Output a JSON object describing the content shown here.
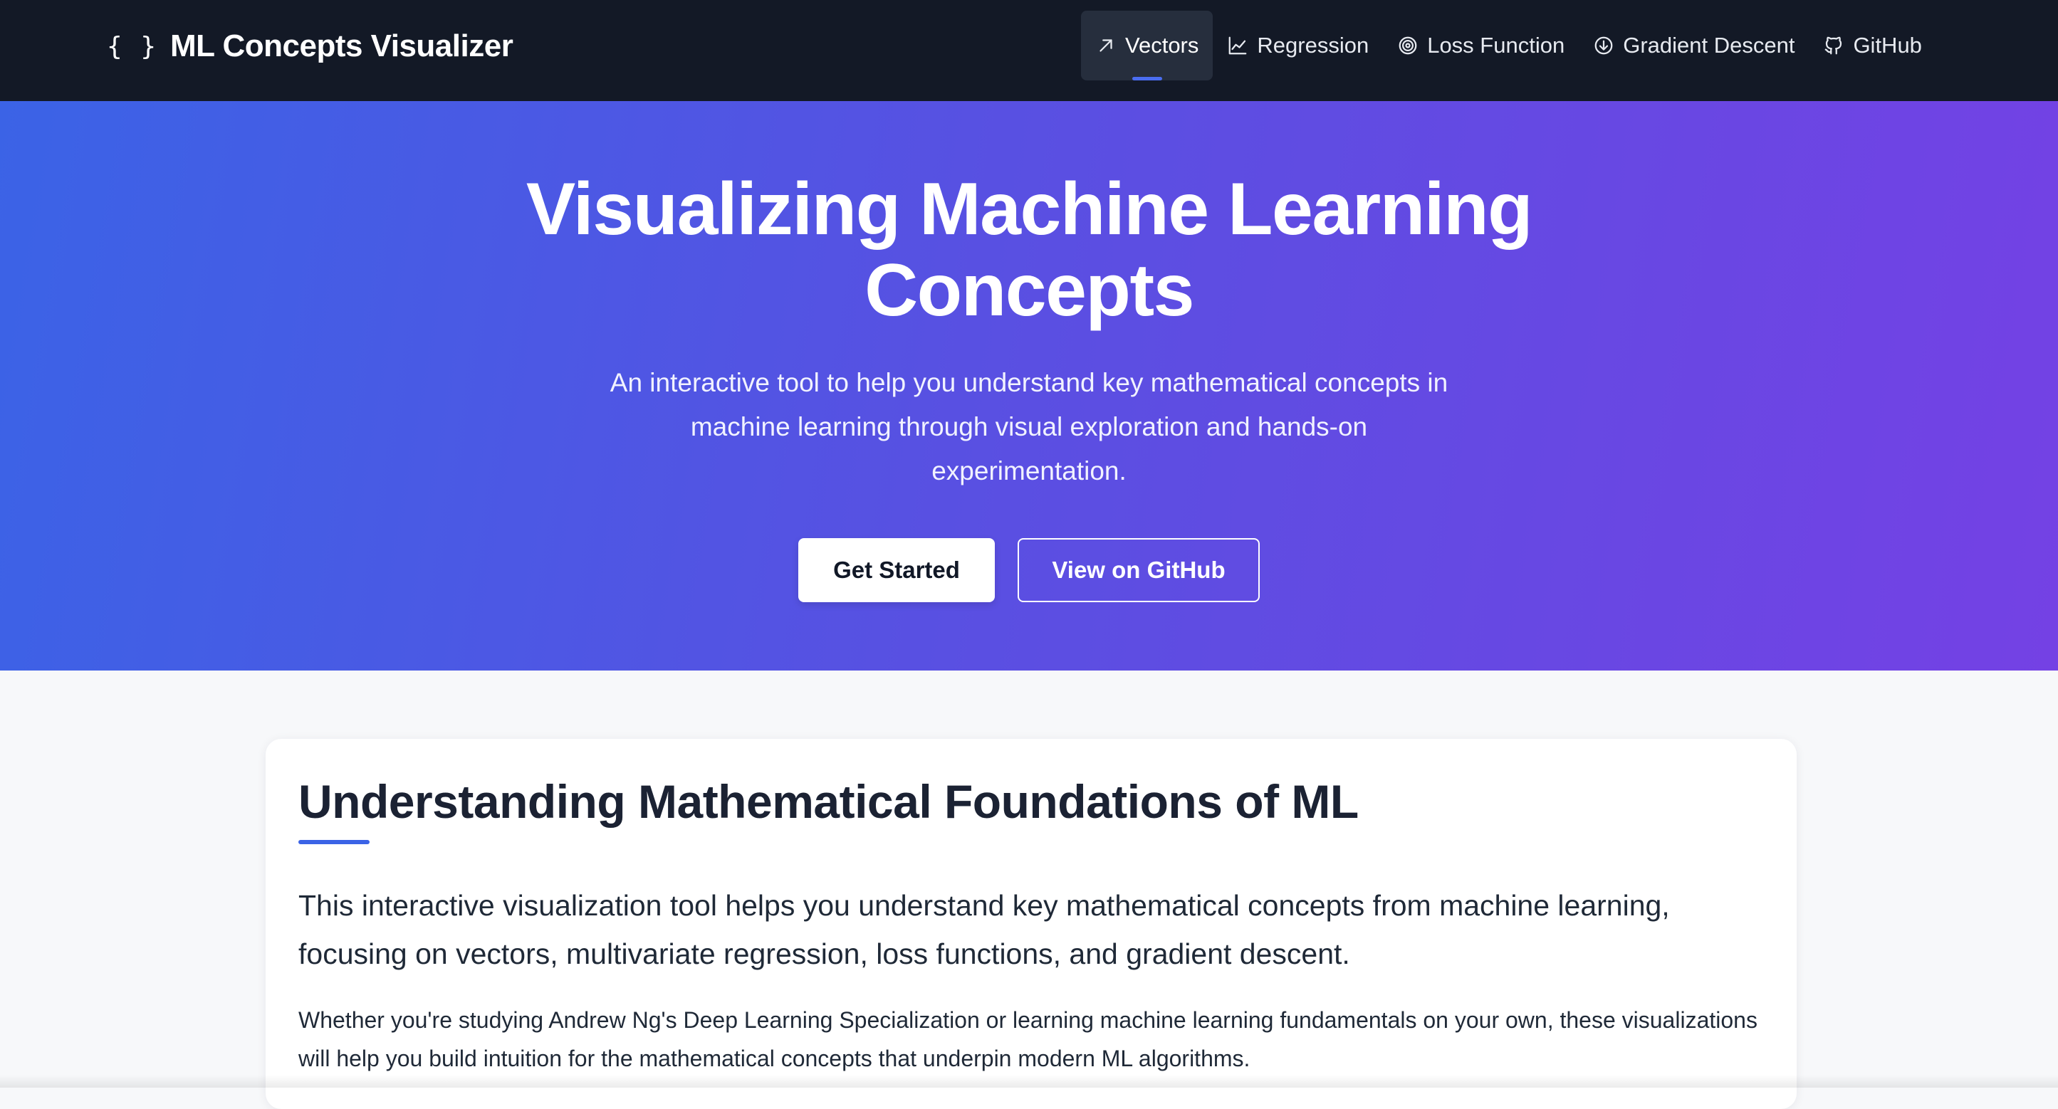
{
  "brand": {
    "icon": "code-braces-icon",
    "icon_text": "{ }",
    "title": "ML Concepts Visualizer"
  },
  "nav": {
    "items": [
      {
        "label": "Vectors",
        "icon": "arrow-up-right-icon",
        "active": true
      },
      {
        "label": "Regression",
        "icon": "line-chart-icon",
        "active": false
      },
      {
        "label": "Loss Function",
        "icon": "target-icon",
        "active": false
      },
      {
        "label": "Gradient Descent",
        "icon": "arrow-down-circle-icon",
        "active": false
      },
      {
        "label": "GitHub",
        "icon": "github-icon",
        "active": false
      }
    ]
  },
  "hero": {
    "title_line1": "Visualizing Machine Learning",
    "title_line2": "Concepts",
    "subtitle": "An interactive tool to help you understand key mathematical concepts in machine learning through visual exploration and hands-on experimentation.",
    "primary_button": "Get Started",
    "secondary_button": "View on GitHub"
  },
  "intro": {
    "title": "Understanding Mathematical Foundations of ML",
    "lead": "This interactive visualization tool helps you understand key mathematical concepts from machine learning, focusing on vectors, multivariate regression, loss functions, and gradient descent.",
    "body": "Whether you're studying Andrew Ng's Deep Learning Specialization or learning machine learning fundamentals on your own, these visualizations will help you build intuition for the mathematical concepts that underpin modern ML algorithms."
  },
  "colors": {
    "navbar_bg": "#131926",
    "hero_gradient_start": "#3b63e6",
    "hero_gradient_end": "#7441e4",
    "accent": "#3b63e6"
  }
}
